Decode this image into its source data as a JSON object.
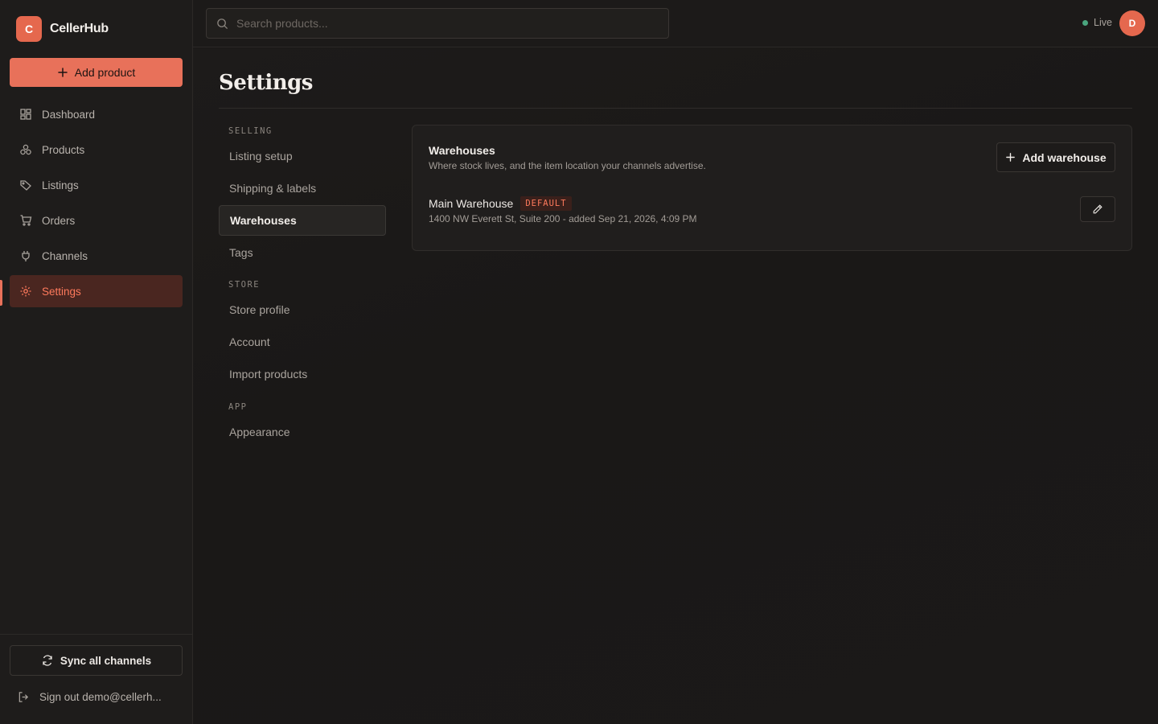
{
  "brand": {
    "logo_letter": "C",
    "name": "CellerHub"
  },
  "sidebar": {
    "add_product_label": "Add product",
    "items": [
      {
        "label": "Dashboard",
        "icon": "dashboard-icon"
      },
      {
        "label": "Products",
        "icon": "products-icon"
      },
      {
        "label": "Listings",
        "icon": "tag-icon"
      },
      {
        "label": "Orders",
        "icon": "cart-icon"
      },
      {
        "label": "Channels",
        "icon": "plug-icon"
      },
      {
        "label": "Settings",
        "icon": "gear-icon",
        "active": true
      }
    ],
    "sync_label": "Sync all channels",
    "signout_label": "Sign out demo@cellerh..."
  },
  "topbar": {
    "search_placeholder": "Search products...",
    "status_label": "Live",
    "avatar_initial": "D"
  },
  "page": {
    "title": "Settings",
    "subnav": {
      "sections": [
        {
          "title": "SELLING",
          "items": [
            "Listing setup",
            "Shipping & labels",
            "Warehouses",
            "Tags"
          ]
        },
        {
          "title": "STORE",
          "items": [
            "Store profile",
            "Account",
            "Import products"
          ]
        },
        {
          "title": "APP",
          "items": [
            "Appearance"
          ]
        }
      ],
      "active": "Warehouses"
    },
    "warehouses": {
      "title": "Warehouses",
      "description": "Where stock lives, and the item location your channels advertise.",
      "add_label": "Add warehouse",
      "items": [
        {
          "name": "Main Warehouse",
          "badge": "DEFAULT",
          "meta": "1400 NW Everett St, Suite 200 - added Sep 21, 2026, 4:09 PM"
        }
      ]
    }
  },
  "colors": {
    "accent": "#e8715a",
    "active_bg": "#4a2620",
    "live": "#4aa57e"
  }
}
